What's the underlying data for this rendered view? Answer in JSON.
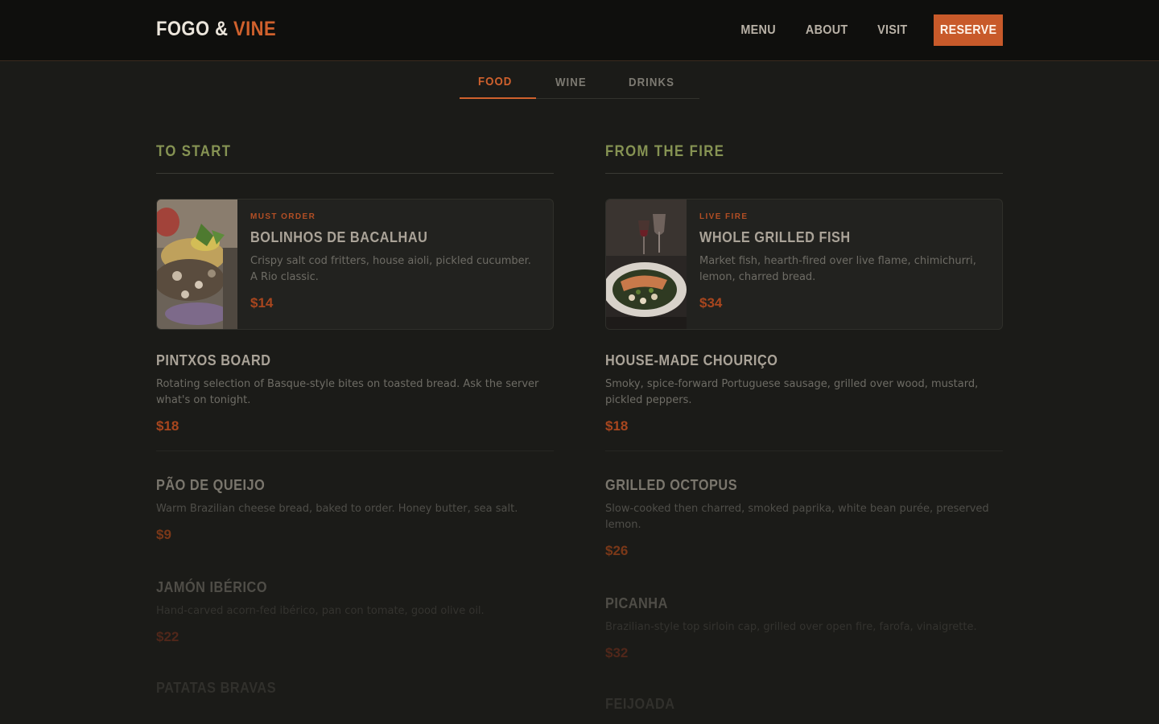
{
  "brand": {
    "part1": "FOGO",
    "amp": "&",
    "part2": "VINE",
    "accent_color": "#d0612d"
  },
  "nav": {
    "items": [
      "MENU",
      "ABOUT",
      "VISIT"
    ],
    "reserve_label": "RESERVE"
  },
  "tabs": [
    {
      "label": "FOOD",
      "active": true
    },
    {
      "label": "WINE",
      "active": false
    },
    {
      "label": "DRINKS",
      "active": false
    }
  ],
  "columns": [
    {
      "title": "TO START",
      "feature": {
        "badge": "MUST ORDER",
        "name": "BOLINHOS DE BACALHAU",
        "desc": "Crispy salt cod fritters, house aioli, pickled cucumber. A Rio classic.",
        "price": "$14",
        "image": "salt-cod-fritters-photo"
      },
      "items": [
        {
          "name": "PINTXOS BOARD",
          "desc": "Rotating selection of Basque-style bites on toasted bread. Ask the server what's on tonight.",
          "price": "$18"
        },
        {
          "name": "PÃO DE QUEIJO",
          "desc": "Warm Brazilian cheese bread, baked to order. Honey butter, sea salt.",
          "price": "$9"
        },
        {
          "name": "JAMÓN IBÉRICO",
          "desc": "Hand-carved acorn-fed ibérico, pan con tomate, good olive oil.",
          "price": "$22"
        },
        {
          "name": "PATATAS BRAVAS"
        }
      ]
    },
    {
      "title": "FROM THE FIRE",
      "feature": {
        "badge": "LIVE FIRE",
        "name": "WHOLE GRILLED FISH",
        "desc": "Market fish, hearth-fired over live flame, chimichurri, lemon, charred bread.",
        "price": "$34",
        "image": "grilled-fish-plate-photo"
      },
      "items": [
        {
          "name": "HOUSE-MADE CHOURIÇO",
          "desc": "Smoky, spice-forward Portuguese sausage, grilled over wood, mustard, pickled peppers.",
          "price": "$18"
        },
        {
          "name": "GRILLED OCTOPUS",
          "desc": "Slow-cooked then charred, smoked paprika, white bean purée, preserved lemon.",
          "price": "$26"
        },
        {
          "name": "PICANHA",
          "desc": "Brazilian-style top sirloin cap, grilled over open fire, farofa, vinaigrette.",
          "price": "$32"
        },
        {
          "name": "FEIJOADA"
        }
      ]
    }
  ]
}
